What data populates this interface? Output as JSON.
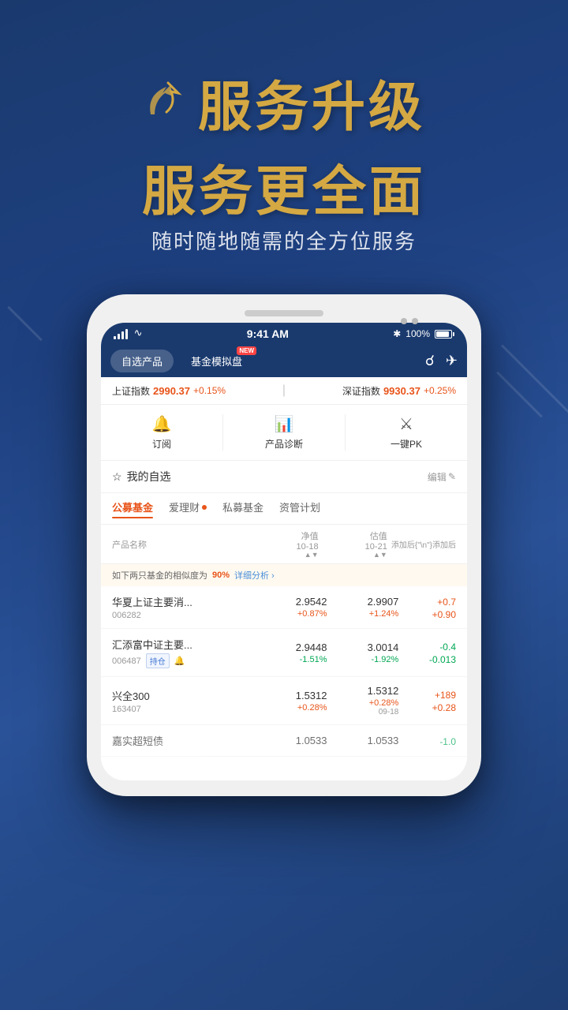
{
  "hero": {
    "title_line1": "服务升级",
    "title_line2": "服务更全面",
    "subtitle": "随时随地随需的全方位服务"
  },
  "phone": {
    "status_bar": {
      "time": "9:41 AM",
      "battery": "100%",
      "bluetooth": "✱"
    },
    "header": {
      "tab1": "自选产品",
      "tab2": "基金模拟盘",
      "tab2_badge": "NEW"
    },
    "index_bar": {
      "left_name": "上证指数",
      "left_value": "2990.37",
      "left_change": "+0.15%",
      "right_name": "深证指数",
      "right_value": "9930.37",
      "right_change": "+0.25%"
    },
    "func_bar": [
      {
        "icon": "🔔",
        "label": "订阅"
      },
      {
        "icon": "📊",
        "label": "产品诊断"
      },
      {
        "icon": "⚔",
        "label": "一键PK"
      }
    ],
    "section": {
      "title_icon": "☆",
      "title": "我的自选",
      "edit": "编辑"
    },
    "cat_tabs": [
      {
        "label": "公募基金",
        "active": true,
        "dot": false
      },
      {
        "label": "爱理财",
        "active": false,
        "dot": true
      },
      {
        "label": "私募基金",
        "active": false,
        "dot": false
      },
      {
        "label": "资管计划",
        "active": false,
        "dot": false
      }
    ],
    "table_header": {
      "col1": "产品名称",
      "col2": "净值",
      "col2_date": "10-18",
      "col3": "估值",
      "col3_date": "10-21",
      "col4": "添加后\n添加后"
    },
    "similarity": {
      "text": "如下两只基金的相似度为",
      "pct": "90%",
      "link": "详细分析 ›"
    },
    "funds": [
      {
        "name": "华夏上证主要消...",
        "code": "006282",
        "tags": [],
        "nav_value": "2.9542",
        "nav_change": "+0.87%",
        "nav_up": true,
        "est_value": "2.9907",
        "est_change": "+1.24%",
        "est_up": true,
        "add_value": "+0.7",
        "add_value2": "+0.90"
      },
      {
        "name": "汇添富中证主要...",
        "code": "006487",
        "tags": [
          "持仓",
          "🔔"
        ],
        "nav_value": "2.9448",
        "nav_change": "-1.51%",
        "nav_up": false,
        "est_value": "3.0014",
        "est_change": "-1.92%",
        "est_up": false,
        "add_value": "-0.4",
        "add_value2": "-0.013"
      },
      {
        "name": "兴全300",
        "code": "163407",
        "tags": [],
        "nav_value": "1.5312",
        "nav_change": "+0.28%",
        "nav_up": true,
        "est_value": "1.5312",
        "est_change": "+0.28%",
        "est_up": true,
        "add_value": "+189",
        "add_value2": "+0.28",
        "extra_date": "09-18"
      },
      {
        "name": "嘉实超短债",
        "code": "",
        "tags": [],
        "nav_value": "1.0533",
        "nav_change": "",
        "nav_up": true,
        "est_value": "1.0533",
        "est_change": "",
        "est_up": true,
        "add_value": "-1.0",
        "add_value2": ""
      }
    ]
  }
}
